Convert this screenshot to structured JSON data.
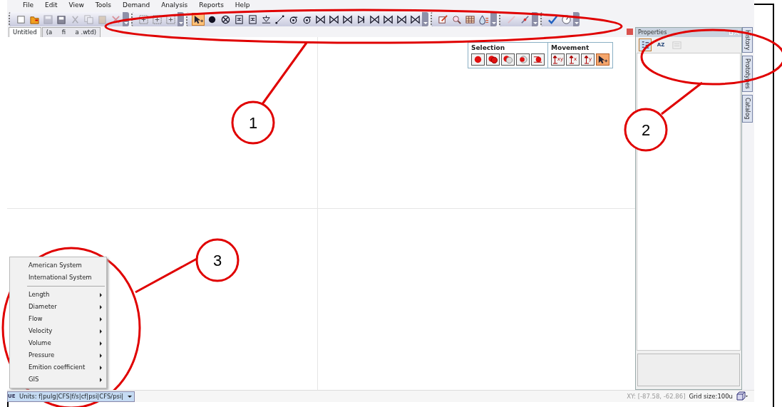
{
  "menu": [
    "File",
    "Edit",
    "View",
    "Tools",
    "Demand",
    "Analysis",
    "Reports",
    "Help"
  ],
  "toolbars": [
    {
      "kind": "buttons",
      "buttons": [
        {
          "kind": "new",
          "disabled": false
        },
        {
          "kind": "open",
          "disabled": false
        },
        {
          "kind": "save",
          "disabled": true
        },
        {
          "kind": "save-as",
          "disabled": false
        },
        {
          "kind": "cut",
          "disabled": true
        },
        {
          "kind": "copy",
          "disabled": true
        },
        {
          "kind": "paste",
          "disabled": true
        },
        {
          "kind": "delete",
          "disabled": true
        }
      ]
    },
    {
      "kind": "buttons",
      "buttons": [
        {
          "kind": "zoom",
          "disabled": false
        },
        {
          "kind": "zoom",
          "disabled": false
        },
        {
          "kind": "zoom",
          "disabled": false
        }
      ]
    },
    {
      "kind": "tools",
      "buttons": [
        {
          "kind": "pointer",
          "selected": true
        },
        {
          "kind": "junction",
          "selected": false
        },
        {
          "kind": "reservoir",
          "selected": false
        },
        {
          "kind": "tank",
          "selected": false
        },
        {
          "kind": "tank",
          "selected": false
        },
        {
          "kind": "hydrant",
          "selected": false
        },
        {
          "kind": "pipe",
          "selected": false
        },
        {
          "kind": "pump",
          "selected": false
        },
        {
          "kind": "pump",
          "selected": false
        },
        {
          "kind": "valve",
          "selected": false
        },
        {
          "kind": "valve",
          "selected": false
        },
        {
          "kind": "valve",
          "selected": false
        },
        {
          "kind": "check-valve",
          "selected": false
        },
        {
          "kind": "valve",
          "selected": false
        },
        {
          "kind": "valve",
          "selected": false
        },
        {
          "kind": "valve",
          "selected": false
        },
        {
          "kind": "valve",
          "selected": false
        }
      ]
    },
    {
      "kind": "buttons",
      "buttons": [
        {
          "kind": "edit",
          "disabled": false
        },
        {
          "kind": "find",
          "disabled": false
        },
        {
          "kind": "table",
          "disabled": false
        },
        {
          "kind": "flow",
          "disabled": false
        }
      ]
    },
    {
      "kind": "buttons",
      "buttons": [
        {
          "kind": "measure",
          "disabled": true
        },
        {
          "kind": "split",
          "disabled": false
        }
      ]
    },
    {
      "kind": "buttons",
      "buttons": [
        {
          "kind": "check",
          "disabled": false
        },
        {
          "kind": "gauge",
          "disabled": false
        }
      ]
    }
  ],
  "document_tabs": [
    {
      "label": "Untitled",
      "selected": true
    },
    {
      "label": "(a     fi     a .wtd)",
      "selected": false
    }
  ],
  "selection_panel": {
    "title": "Selection",
    "buttons": [
      {
        "kind": "sel-one"
      },
      {
        "kind": "sel-two"
      },
      {
        "kind": "sel-half"
      },
      {
        "kind": "sel-ring"
      },
      {
        "kind": "sel-swap"
      }
    ]
  },
  "movement_panel": {
    "title": "Movement",
    "buttons": [
      {
        "label": "xy",
        "selected": false
      },
      {
        "label": "x",
        "selected": false
      },
      {
        "label": "y",
        "selected": false
      },
      {
        "kind": "pointer",
        "selected": true
      }
    ]
  },
  "properties": {
    "title": "Properties",
    "tools": [
      {
        "kind": "categorized",
        "selected": true,
        "disabled": false
      },
      {
        "kind": "alphabetical",
        "label": "AZ",
        "selected": false,
        "disabled": false
      },
      {
        "kind": "pages",
        "selected": false,
        "disabled": true
      }
    ]
  },
  "side_tabs": [
    "History",
    "Prototypes",
    "Catalog"
  ],
  "context_menu": {
    "items": [
      {
        "kind": "item",
        "label": "American System"
      },
      {
        "kind": "item",
        "label": "International System"
      },
      {
        "kind": "separator"
      },
      {
        "kind": "submenu",
        "label": "Length"
      },
      {
        "kind": "submenu",
        "label": "Diameter"
      },
      {
        "kind": "submenu",
        "label": "Flow"
      },
      {
        "kind": "submenu",
        "label": "Velocity"
      },
      {
        "kind": "submenu",
        "label": "Volume"
      },
      {
        "kind": "submenu",
        "label": "Pressure"
      },
      {
        "kind": "submenu",
        "label": "Emition coefficient"
      },
      {
        "kind": "submenu",
        "label": "GIS"
      }
    ]
  },
  "status_bar": {
    "units_icon_text": "UE",
    "units": "Units: f|pulg|CFS|f/s|cf|psi|CFS/psi|",
    "coordinates": "XY: [-87.58, -62.86]",
    "grid_size": "Grid size:100u"
  },
  "callouts": [
    {
      "number": "1"
    },
    {
      "number": "2"
    },
    {
      "number": "3"
    }
  ]
}
